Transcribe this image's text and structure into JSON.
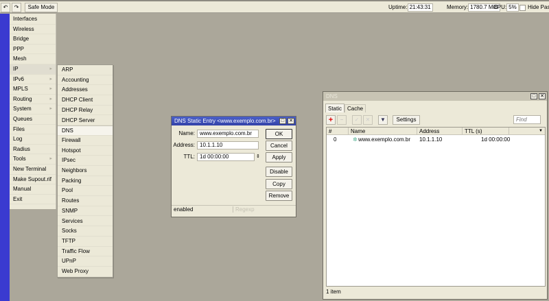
{
  "toolbar": {
    "safe_mode": "Safe Mode",
    "uptime_label": "Uptime:",
    "uptime": "21:43:31",
    "memory_label": "Memory:",
    "memory": "1780.7 MiB",
    "cpu_label": "CPU:",
    "cpu": "5%",
    "hide_passwords": "Hide Pass"
  },
  "menu": [
    "Interfaces",
    "Wireless",
    "Bridge",
    "PPP",
    "Mesh",
    "IP",
    "IPv6",
    "MPLS",
    "Routing",
    "System",
    "Queues",
    "Files",
    "Log",
    "Radius",
    "Tools",
    "New Terminal",
    "Make Supout.rif",
    "Manual",
    "Exit"
  ],
  "submenu": [
    "ARP",
    "Accounting",
    "Addresses",
    "DHCP Client",
    "DHCP Relay",
    "DHCP Server",
    "DNS",
    "Firewall",
    "Hotspot",
    "IPsec",
    "Neighbors",
    "Packing",
    "Pool",
    "Routes",
    "SNMP",
    "Services",
    "Socks",
    "TFTP",
    "Traffic Flow",
    "UPnP",
    "Web Proxy"
  ],
  "dialog": {
    "title": "DNS Static Entry <www.exemplo.com.br>",
    "name_label": "Name:",
    "name": "www.exemplo.com.br",
    "address_label": "Address:",
    "address": "10.1.1.10",
    "ttl_label": "TTL:",
    "ttl": "1d 00:00:00",
    "ok": "OK",
    "cancel": "Cancel",
    "apply": "Apply",
    "disable": "Disable",
    "copy": "Copy",
    "remove": "Remove",
    "status": "enabled",
    "regexp": "Regexp"
  },
  "dns": {
    "title": "DNS",
    "tabs": [
      "Static",
      "Cache"
    ],
    "settings": "Settings",
    "find_placeholder": "Find",
    "columns": [
      "#",
      "Name",
      "Address",
      "TTL (s)"
    ],
    "rows": [
      {
        "num": "0",
        "name": "www.exemplo.com.br",
        "address": "10.1.1.10",
        "ttl": "1d 00:00:00"
      }
    ],
    "status": "1 item"
  }
}
